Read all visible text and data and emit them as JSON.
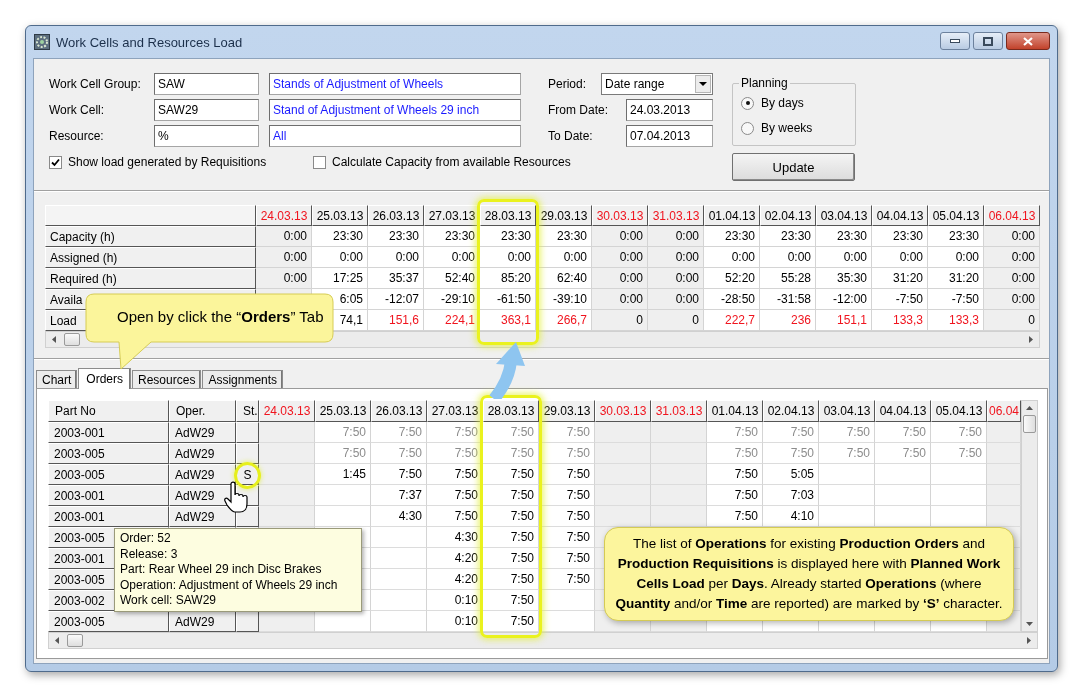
{
  "window": {
    "title": "Work Cells and Resources Load"
  },
  "filters": [
    {
      "label": "Work Cell Group:",
      "code": "SAW",
      "description": "Stands of Adjustment of Wheels"
    },
    {
      "label": "Work Cell:",
      "code": "SAW29",
      "description": "Stand of Adjustment of Wheels 29 inch"
    },
    {
      "label": "Resource:",
      "code": "%",
      "description": "All"
    }
  ],
  "options": [
    {
      "label": "Show load generated by Requisitions",
      "checked": true
    },
    {
      "label": "Calculate Capacity from available Resources",
      "checked": false
    }
  ],
  "period": {
    "label": "Period:",
    "value": "Date range"
  },
  "dates": [
    {
      "label": "From Date:",
      "value": "24.03.2013"
    },
    {
      "label": "To Date:",
      "value": "07.04.2013"
    }
  ],
  "planning": {
    "title": "Planning",
    "choices": [
      {
        "label": "By days",
        "selected": true
      },
      {
        "label": "By weeks",
        "selected": false
      }
    ]
  },
  "update_button": "Update",
  "load_grid": {
    "columns": [
      {
        "label": "24.03.13",
        "weekend": true
      },
      {
        "label": "25.03.13",
        "weekend": false
      },
      {
        "label": "26.03.13",
        "weekend": false
      },
      {
        "label": "27.03.13",
        "weekend": false
      },
      {
        "label": "28.03.13",
        "weekend": false
      },
      {
        "label": "29.03.13",
        "weekend": false
      },
      {
        "label": "30.03.13",
        "weekend": true
      },
      {
        "label": "31.03.13",
        "weekend": true
      },
      {
        "label": "01.04.13",
        "weekend": false
      },
      {
        "label": "02.04.13",
        "weekend": false
      },
      {
        "label": "03.04.13",
        "weekend": false
      },
      {
        "label": "04.04.13",
        "weekend": false
      },
      {
        "label": "05.04.13",
        "weekend": false
      },
      {
        "label": "06.04.13",
        "weekend": true
      }
    ],
    "rows": [
      {
        "label": "Capacity (h)",
        "values": {
          "0": "0:00",
          "1": "23:30",
          "2": "23:30",
          "3": "23:30",
          "4": "23:30",
          "5": "23:30",
          "6": "0:00",
          "7": "0:00",
          "8": "23:30",
          "9": "23:30",
          "10": "23:30",
          "11": "23:30",
          "12": "23:30",
          "13": "0:00"
        }
      },
      {
        "label": "Assigned (h)",
        "values": {
          "0": "0:00",
          "1": "0:00",
          "2": "0:00",
          "3": "0:00",
          "4": "0:00",
          "5": "0:00",
          "6": "0:00",
          "7": "0:00",
          "8": "0:00",
          "9": "0:00",
          "10": "0:00",
          "11": "0:00",
          "12": "0:00",
          "13": "0:00"
        }
      },
      {
        "label": "Required (h)",
        "values": {
          "0": "0:00",
          "1": "17:25",
          "2": "35:37",
          "3": "52:40",
          "4": "85:20",
          "5": "62:40",
          "6": "0:00",
          "7": "0:00",
          "8": "52:20",
          "9": "55:28",
          "10": "35:30",
          "11": "31:20",
          "12": "31:20",
          "13": "0:00"
        }
      },
      {
        "label": "Availa",
        "values": {
          "1": "6:05",
          "2": "-12:07",
          "3": "-29:10",
          "4": "-61:50",
          "5": "-39:10",
          "6": "0:00",
          "7": "0:00",
          "8": "-28:50",
          "9": "-31:58",
          "10": "-12:00",
          "11": "-7:50",
          "12": "-7:50",
          "13": "0:00"
        }
      },
      {
        "label": "Load",
        "values": {
          "1": "74,1",
          "2": "151,6",
          "3": "224,1",
          "4": "363,1",
          "5": "266,7",
          "6": "0",
          "7": "0",
          "8": "222,7",
          "9": "236",
          "10": "151,1",
          "11": "133,3",
          "12": "133,3",
          "13": "0"
        },
        "overloaded": [
          false,
          false,
          true,
          true,
          true,
          true,
          false,
          false,
          true,
          true,
          true,
          true,
          true,
          false
        ]
      }
    ]
  },
  "tabs": [
    {
      "label": "Chart",
      "selected": false
    },
    {
      "label": "Orders",
      "selected": true
    },
    {
      "label": "Resources",
      "selected": false
    },
    {
      "label": "Assignments",
      "selected": false
    }
  ],
  "orders_grid": {
    "headers": [
      "Part No",
      "Oper.",
      "St."
    ],
    "columns": [
      {
        "label": "24.03.13",
        "weekend": true
      },
      {
        "label": "25.03.13",
        "weekend": false
      },
      {
        "label": "26.03.13",
        "weekend": false
      },
      {
        "label": "27.03.13",
        "weekend": false
      },
      {
        "label": "28.03.13",
        "weekend": false
      },
      {
        "label": "29.03.13",
        "weekend": false
      },
      {
        "label": "30.03.13",
        "weekend": true
      },
      {
        "label": "31.03.13",
        "weekend": true
      },
      {
        "label": "01.04.13",
        "weekend": false
      },
      {
        "label": "02.04.13",
        "weekend": false
      },
      {
        "label": "03.04.13",
        "weekend": false
      },
      {
        "label": "04.04.13",
        "weekend": false
      },
      {
        "label": "05.04.13",
        "weekend": false
      },
      {
        "label": "06.04",
        "weekend": true
      }
    ],
    "rows": [
      {
        "part": "2003-001",
        "oper": "AdW29",
        "kind": "requisition",
        "values": {
          "1": "7:50",
          "2": "7:50",
          "3": "7:50",
          "4": "7:50",
          "5": "7:50",
          "8": "7:50",
          "9": "7:50",
          "10": "7:50",
          "11": "7:50",
          "12": "7:50"
        }
      },
      {
        "part": "2003-005",
        "oper": "AdW29",
        "kind": "requisition",
        "values": {
          "1": "7:50",
          "2": "7:50",
          "3": "7:50",
          "4": "7:50",
          "5": "7:50",
          "8": "7:50",
          "9": "7:50",
          "10": "7:50",
          "11": "7:50",
          "12": "7:50"
        }
      },
      {
        "part": "2003-005",
        "oper": "AdW29",
        "status": "S",
        "kind": "order",
        "values": {
          "1": "1:45",
          "2": "7:50",
          "3": "7:50",
          "4": "7:50",
          "5": "7:50",
          "8": "7:50",
          "9": "5:05"
        }
      },
      {
        "part": "2003-001",
        "oper": "AdW29",
        "kind": "order",
        "values": {
          "2": "7:37",
          "3": "7:50",
          "4": "7:50",
          "5": "7:50",
          "8": "7:50",
          "9": "7:03"
        }
      },
      {
        "part": "2003-001",
        "oper": "AdW29",
        "kind": "order",
        "values": {
          "2": "4:30",
          "3": "7:50",
          "4": "7:50",
          "5": "7:50",
          "8": "7:50",
          "9": "4:10"
        }
      },
      {
        "part": "2003-005",
        "kind": "order",
        "values": {
          "3": "4:30",
          "4": "7:50",
          "5": "7:50"
        }
      },
      {
        "part": "2003-001",
        "kind": "order",
        "values": {
          "3": "4:20",
          "4": "7:50",
          "5": "7:50"
        }
      },
      {
        "part": "2003-005",
        "kind": "order",
        "values": {
          "3": "4:20",
          "4": "7:50",
          "5": "7:50"
        }
      },
      {
        "part": "2003-002",
        "kind": "order",
        "values": {
          "3": "0:10",
          "4": "7:50"
        }
      },
      {
        "part": "2003-005",
        "oper": "AdW29",
        "kind": "order",
        "values": {
          "3": "0:10",
          "4": "7:50"
        }
      }
    ]
  },
  "annotations": {
    "tab_callout": "Open by click the “**Orders**” Tab",
    "tooltip": [
      "Order: 52",
      "Release: 3",
      "Part: Rear Wheel 29 inch Disc Brakes",
      "Operation: Adjustment of Wheels 29 inch",
      "Work cell: SAW29"
    ],
    "info_callout": "The list of **Operations** for existing **Production Orders** and **Production Requisitions** is displayed here with **Planned Work Cells Load** per **Days**. Already started **Operations** (where **Quantity** and/or **Time** are reported) are marked by **‘S’** character."
  }
}
